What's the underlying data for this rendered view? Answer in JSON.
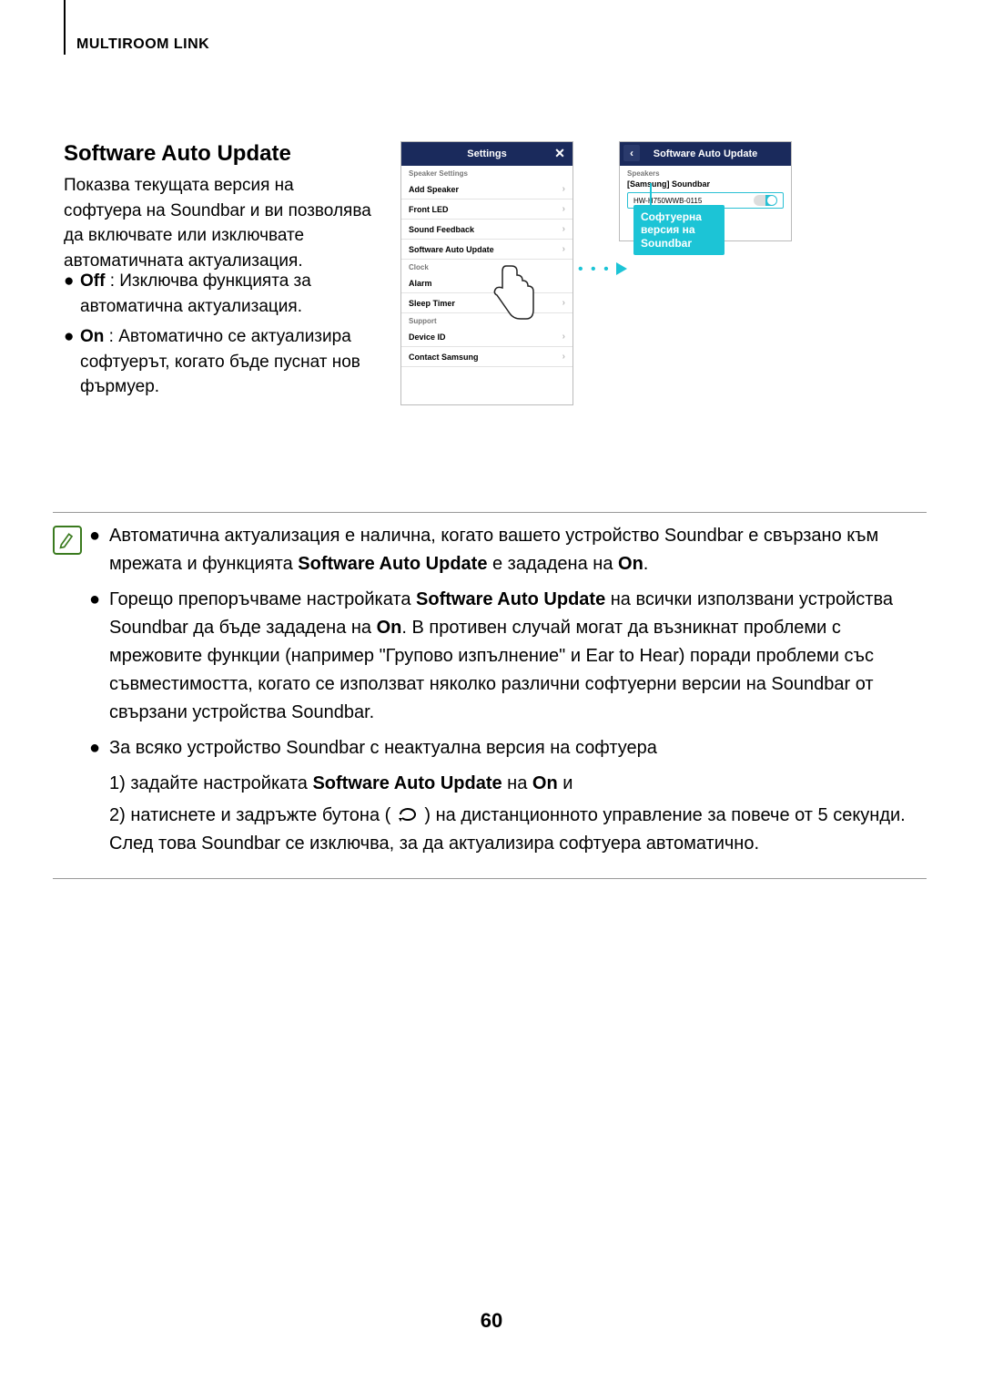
{
  "header": {
    "section": "MULTIROOM LINK"
  },
  "heading": "Software Auto Update",
  "intro": "Показва текущата версия на софтуера на Soundbar и ви позволява да включвате или изключвате автоматичната актуализация.",
  "options": {
    "off_label": "Off",
    "off_text": " : Изключва функцията за автоматична актуализация.",
    "on_label": "On",
    "on_text": " : Автоматично се актуализира софтуерът, когато бъде пуснат нов фърмуер."
  },
  "phone_settings": {
    "title": "Settings",
    "section1": "Speaker Settings",
    "rows1": [
      "Add Speaker",
      "Front LED",
      "Sound Feedback",
      "Software Auto Update"
    ],
    "section2": "Clock",
    "rows2": [
      "Alarm",
      "Sleep Timer"
    ],
    "section3": "Support",
    "rows3": [
      "Device ID",
      "Contact Samsung"
    ]
  },
  "phone_update": {
    "title": "Software Auto Update",
    "section": "Speakers",
    "device_name": "[Samsung] Soundbar",
    "device_sub": "HW-H750WWB-0115",
    "toggle_off": "Off",
    "toggle_on": "On"
  },
  "callout": "Софтуерна версия на Soundbar",
  "note": {
    "b1_a": "Автоматична актуализация е налична, когато вашето устройство Soundbar е свързано към мрежата и функцията ",
    "b1_bold1": "Software Auto Update",
    "b1_b": " е зададена на ",
    "b1_bold2": "On",
    "b1_c": ".",
    "b2_a": "Горещо препоръчваме настройката ",
    "b2_bold1": "Software Auto Update",
    "b2_b": " на всички използвани устройства Soundbar да бъде зададена на ",
    "b2_bold2": "On",
    "b2_c": ". В противен случай могат да възникнат проблеми с мрежовите функции (например \"Групово изпълнение\" и Ear to Hear) поради проблеми със съвместимостта, когато се използват няколко различни софтуерни версии на Soundbar от свързани устройства Soundbar.",
    "b3": "За всяко устройство Soundbar с неактуална версия на софтуера",
    "s1_a": "1) задайте настройката ",
    "s1_bold1": "Software Auto Update",
    "s1_b": " на ",
    "s1_bold2": "On",
    "s1_c": " и",
    "s2_a": "2) натиснете и задръжте бутона ( ",
    "s2_b": " ) на дистанционното управление за повече от 5 секунди. След това Soundbar се изключва, за да актуализира софтуера автоматично."
  },
  "page_number": "60"
}
